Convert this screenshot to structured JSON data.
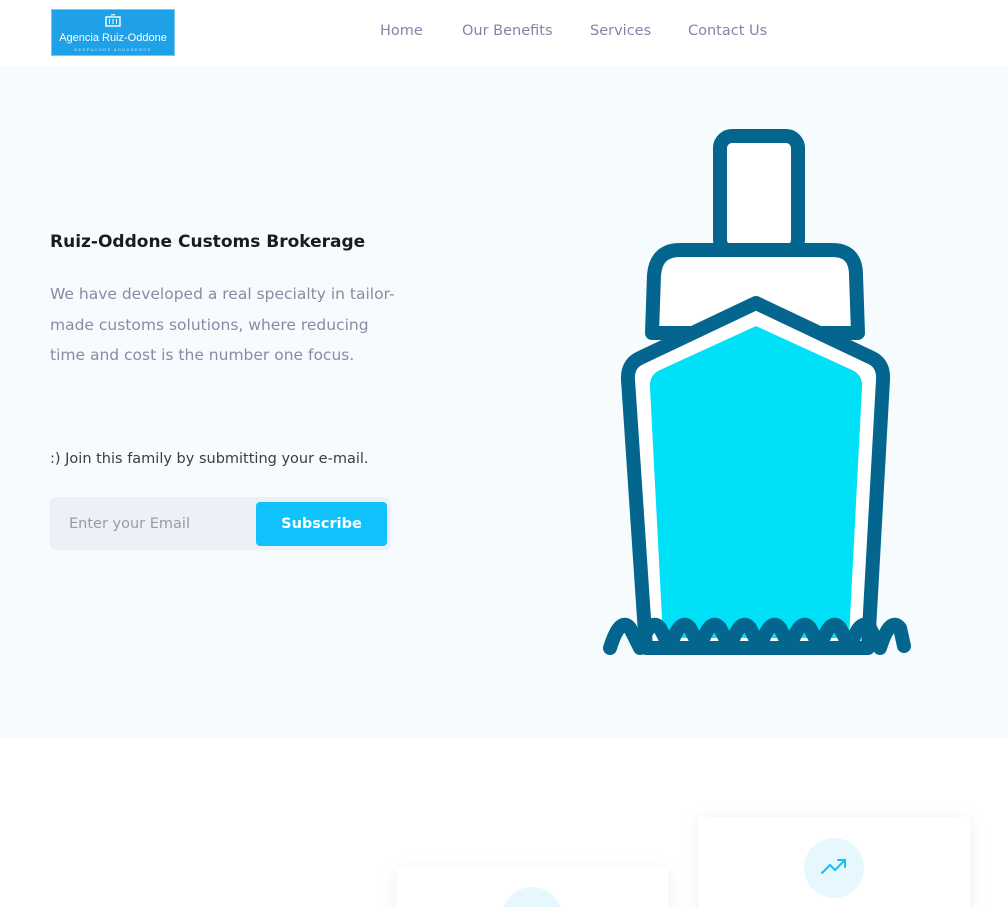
{
  "brand": {
    "name": "Agencia Ruiz-Oddone",
    "tagline": "DESPACHOS ADUANEROS",
    "color": "#1ea1e6"
  },
  "nav": {
    "items": [
      {
        "label": "Home"
      },
      {
        "label": "Our Benefits"
      },
      {
        "label": "Services"
      },
      {
        "label": "Contact Us"
      }
    ]
  },
  "hero": {
    "title": "Ruiz-Oddone Customs Brokerage",
    "description": "We have developed a real specialty in tailor-made customs solutions, where reducing time and cost is the number one focus.",
    "join_text": ":) Join this family by submitting your e-mail.",
    "email_placeholder": "Enter your Email",
    "subscribe_label": "Subscribe",
    "illustration_icon": "ship-icon"
  },
  "cards": [
    {
      "icon": "arrow-up-icon"
    },
    {
      "icon": "trending-up-icon"
    }
  ],
  "colors": {
    "accent": "#0fc2fb",
    "ship_outline": "#04668e",
    "ship_fill": "#00e0f7",
    "hero_background": "#f6fcfd",
    "nav_text": "#8683a6"
  }
}
